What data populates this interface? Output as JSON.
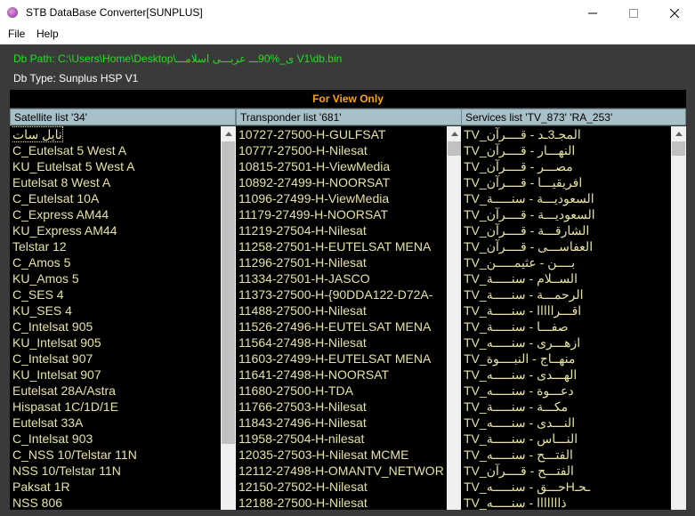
{
  "window": {
    "title": "STB DataBase Converter[SUNPLUS]"
  },
  "menu": [
    "File",
    "Help"
  ],
  "info": {
    "db_path": "Db Path: C:\\Users\\Home\\Desktop\\ى_%90ـــ عربـــى اسلامـــ V1\\db.bin",
    "db_type": "Db Type: Sunplus HSP V1"
  },
  "banner": "For View Only",
  "columns": {
    "satellite": "Satellite list '34'",
    "transponder": "Transponder list '681'",
    "services": "Services list 'TV_873' 'RA_253'"
  },
  "satellites": [
    "نايل سات",
    "C_Eutelsat 5 West A",
    "KU_Eutelsat 5 West A",
    "Eutelsat 8 West A",
    "C_Eutelsat 10A",
    "C_Express AM44",
    "KU_Express AM44",
    "Telstar 12",
    "C_Amos 5",
    "KU_Amos 5",
    "C_SES 4",
    "KU_SES 4",
    "C_Intelsat 905",
    "KU_Intelsat 905",
    "C_Intelsat 907",
    "KU_Intelsat 907",
    "Eutelsat 28A/Astra",
    "Hispasat 1C/1D/1E",
    "Eutelsat 33A",
    "C_Intelsat 903",
    "C_NSS 10/Telstar 11N",
    "NSS 10/Telstar 11N",
    "Paksat 1R",
    "NSS 806"
  ],
  "transponders": [
    "10727-27500-H-GULFSAT",
    "10777-27500-H-Nilesat",
    "10815-27501-H-ViewMedia",
    "10892-27499-H-NOORSAT",
    "11096-27499-H-ViewMedia",
    "11179-27499-H-NOORSAT",
    "11219-27504-H-Nilesat",
    "11258-27501-H-EUTELSAT MENA",
    "11296-27501-H-Nilesat",
    "11334-27501-H-JASCO",
    "11373-27500-H-{90DDA122-D72A-",
    "11488-27500-H-Nilesat",
    "11526-27496-H-EUTELSAT MENA",
    "11564-27498-H-Nilesat",
    "11603-27499-H-EUTELSAT MENA",
    "11641-27498-H-NOORSAT",
    "11680-27500-H-TDA",
    "11766-27503-H-Nilesat",
    "11843-27496-H-Nilesat",
    "11958-27504-H-nilesat",
    "12035-27503-H-Nilesat MCME",
    "12112-27498-H-OMANTV_NETWOR",
    "12150-27502-H-Nilesat",
    "12188-27500-H-Nilesat"
  ],
  "services": [
    "TV_المجـ3ـد - قــــرآن",
    "TV_النهـــار - قــــرآن",
    "TV_مصـــر - قــــرآن",
    "TV_افريقيـــا - قــــرآن",
    "TV_السعوديـــة - سنـــــة",
    "TV_السعوديـــة - قــــرآن",
    "TV_الشارقـــة - قــــرآن",
    "TV_العفاســـى - قــــرآن",
    "TV_بــــن - عثيمـــــن",
    "TV_الســلام - سنـــــة",
    "TV_الرحمـــة - سنـــــة",
    "TV_اقـــرااااا - سنـــــة",
    "TV_صفـــا - سنـــــة",
    "TV_ازهـــرى - سنـــــه",
    "TV_منهــاج - النبــــوة",
    "TV_الهـــدى - سنـــــه",
    "TV_دعـــوة - سنـــــه",
    "TV_مكـــة - سنـــــة",
    "TV_النـــدى - سنـــــه",
    "TV_النـــاس - سنـــــة",
    "TV_الفتـــح - سنـــــه",
    "TV_الفتـــح - قــــرآن",
    "TV_حـــق - سنـــــهHـحـ",
    "TV_ذااااااا - سنـــــه"
  ],
  "icons": {
    "app": "app-icon",
    "minimize": "minimize-icon",
    "maximize": "maximize-icon",
    "close": "close-icon"
  }
}
